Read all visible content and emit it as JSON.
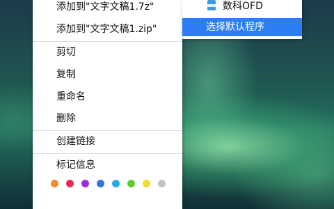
{
  "context_menu": {
    "items": [
      {
        "label": "添加到\"文字文稿1.7z\""
      },
      {
        "label": "添加到\"文字文稿1.zip\""
      },
      {
        "label": "剪切"
      },
      {
        "label": "复制"
      },
      {
        "label": "重命名"
      },
      {
        "label": "删除"
      },
      {
        "label": "创建链接"
      },
      {
        "label": "标记信息"
      }
    ],
    "tag_colors": [
      "#f08c2a",
      "#ea2a4c",
      "#9b30d9",
      "#3772e0",
      "#22aede",
      "#5ccb2e",
      "#f2dc2e",
      "#c2c2c2"
    ]
  },
  "submenu": {
    "items": [
      {
        "label": "数科OFD",
        "icon": "ofd-app-icon"
      },
      {
        "label": "选择默认程序",
        "highlighted": true
      }
    ]
  },
  "colors": {
    "highlight": "#2d7df6"
  }
}
